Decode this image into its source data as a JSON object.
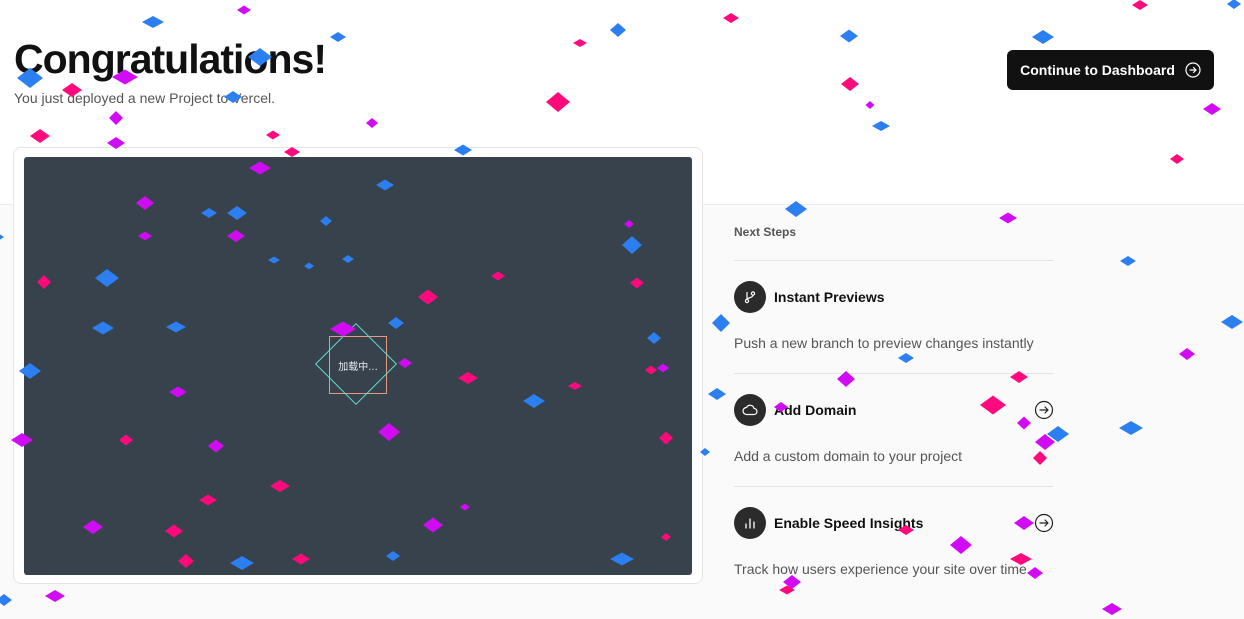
{
  "header": {
    "title": "Congratulations!",
    "subtitle": "You just deployed a new Project to Vercel.",
    "cta_label": "Continue to Dashboard"
  },
  "preview": {
    "loading_text": "加载中..."
  },
  "next_steps": {
    "heading": "Next Steps",
    "items": [
      {
        "icon": "git-branch-icon",
        "title": "Instant Previews",
        "description": "Push a new branch to preview changes instantly",
        "has_arrow": false
      },
      {
        "icon": "cloud-icon",
        "title": "Add Domain",
        "description": "Add a custom domain to your project",
        "has_arrow": true
      },
      {
        "icon": "bar-chart-icon",
        "title": "Enable Speed Insights",
        "description": "Track how users experience your site over time",
        "has_arrow": true
      }
    ]
  },
  "colors": {
    "confetti_pink": "#ff0a7c",
    "confetti_magenta": "#d10cf5",
    "confetti_blue": "#2b7ff0",
    "button_bg": "#111111",
    "preview_bg": "#37424c"
  }
}
